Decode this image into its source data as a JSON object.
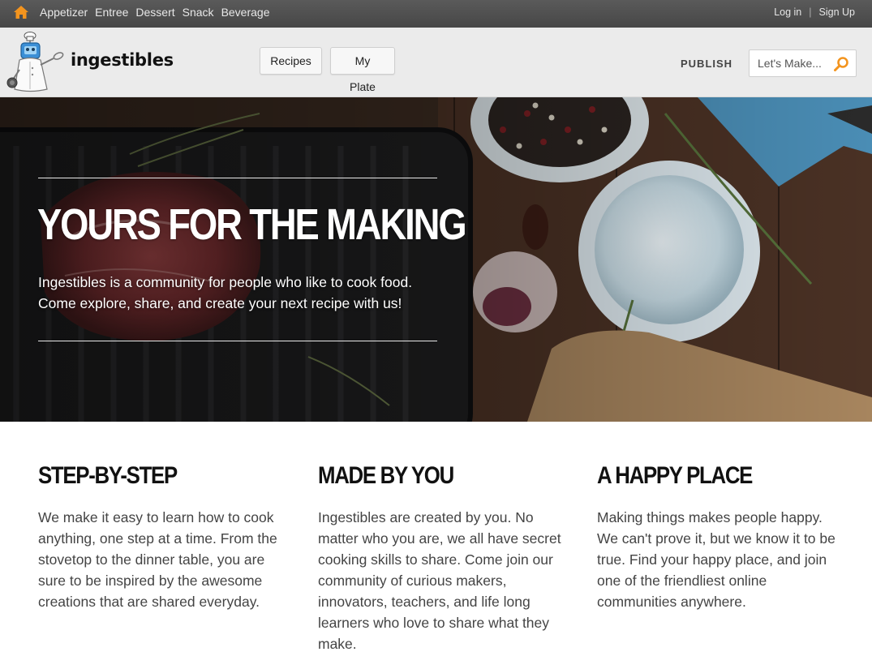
{
  "topbar": {
    "categories": [
      "Appetizer",
      "Entree",
      "Dessert",
      "Snack",
      "Beverage"
    ],
    "login": "Log in",
    "signup": "Sign Up"
  },
  "header": {
    "brand": "ingestibles",
    "nav": {
      "recipes": "Recipes",
      "my_plate": "My Plate"
    },
    "publish": "PUBLISH",
    "search_placeholder": "Let's Make..."
  },
  "hero": {
    "title": "YOURS FOR THE MAKING",
    "line1": "Ingestibles is a community for people who like to cook food.",
    "line2": "Come explore, share, and create your next recipe with us!"
  },
  "features": [
    {
      "title": "STEP-BY-STEP",
      "text": "We make it easy to learn how to cook anything, one step at a time. From the stovetop to the dinner table, you are sure to be inspired by the awesome creations that are shared everyday."
    },
    {
      "title": "MADE BY YOU",
      "text": "Ingestibles are created by you. No matter who you are, we all have secret cooking skills to share. Come join our community of curious makers, innovators, teachers, and life long learners who love to share what they make."
    },
    {
      "title": "A HAPPY PLACE",
      "text": "Making things makes people happy. We can't prove it, but we know it to be true. Find your happy place, and join one of the friendliest online communities anywhere."
    }
  ],
  "colors": {
    "topbar": "#4f4f4f",
    "header": "#ebebeb",
    "accent": "#f3941e"
  },
  "icons": {
    "home": "home-icon",
    "search": "search-icon",
    "logo": "robot-chef-logo"
  }
}
